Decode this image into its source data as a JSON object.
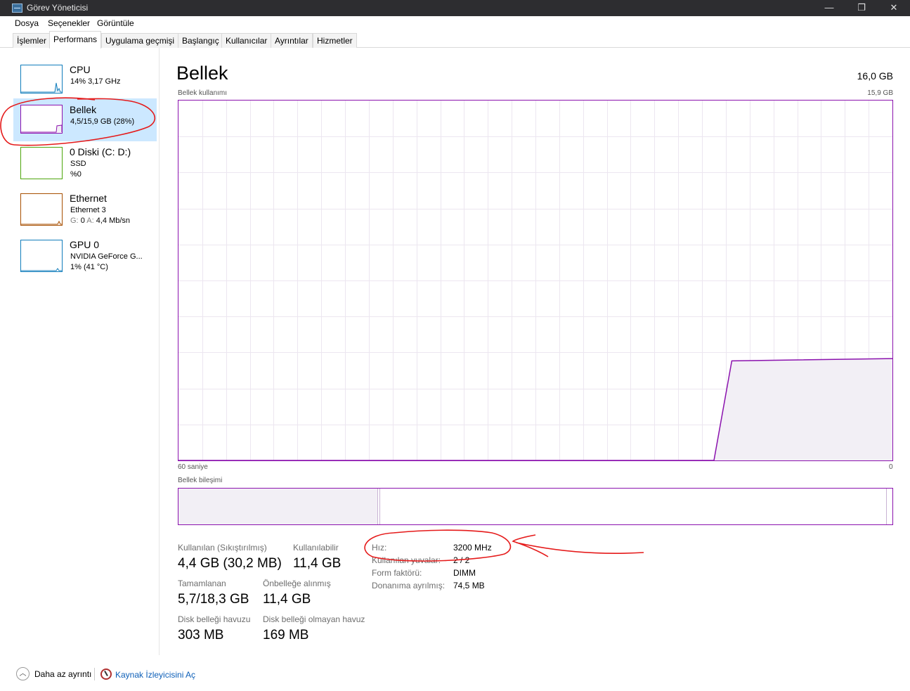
{
  "window": {
    "title": "Görev Yöneticisi",
    "minimize_glyph": "—",
    "maximize_glyph": "❐",
    "close_glyph": "✕"
  },
  "menu": [
    "Dosya",
    "Seçenekler",
    "Görüntüle"
  ],
  "tabs": [
    {
      "label": "İşlemler",
      "active": false
    },
    {
      "label": "Performans",
      "active": true
    },
    {
      "label": "Uygulama geçmişi",
      "active": false
    },
    {
      "label": "Başlangıç",
      "active": false
    },
    {
      "label": "Kullanıcılar",
      "active": false
    },
    {
      "label": "Ayrıntılar",
      "active": false
    },
    {
      "label": "Hizmetler",
      "active": false
    }
  ],
  "sidebar": {
    "items": [
      {
        "name": "CPU",
        "sub1": "14% 3,17 GHz",
        "sub2": "",
        "color": "#117dbb",
        "selected": false
      },
      {
        "name": "Bellek",
        "sub1": "4,5/15,9 GB (28%)",
        "sub2": "",
        "color": "#8b12ae",
        "selected": true
      },
      {
        "name": "0 Diski (C: D:)",
        "sub1": "SSD",
        "sub2": "%0",
        "color": "#4da60c",
        "selected": false
      },
      {
        "name": "Ethernet",
        "sub1": "Ethernet 3",
        "sub2_prefix_g": "G:",
        "sub2_g": "0",
        "sub2_prefix_a": "A:",
        "sub2_a": "4,4 Mb/sn",
        "color": "#a74f01",
        "selected": false
      },
      {
        "name": "GPU 0",
        "sub1": "NVIDIA GeForce G...",
        "sub2": "1% (41 °C)",
        "color": "#117dbb",
        "selected": false
      }
    ]
  },
  "main": {
    "title": "Bellek",
    "total": "16,0 GB",
    "usage_label": "Bellek kullanımı",
    "usage_max": "15,9 GB",
    "time_label": "60 saniye",
    "time_end": "0",
    "composition_label": "Bellek bileşimi",
    "graph_color": "#8b12ae",
    "composition": {
      "in_use_fraction": 0.28,
      "modified_fraction": 0.003,
      "standby_fraction": 0.71
    }
  },
  "stats": {
    "in_use_label": "Kullanılan (Sıkıştırılmış)",
    "in_use_value": "4,4 GB (30,2 MB)",
    "available_label": "Kullanılabilir",
    "available_value": "11,4 GB",
    "committed_label": "Tamamlanan",
    "committed_value": "5,7/18,3 GB",
    "cached_label": "Önbelleğe alınmış",
    "cached_value": "11,4 GB",
    "paged_label": "Disk belleği havuzu",
    "paged_value": "303 MB",
    "nonpaged_label": "Disk belleği olmayan havuz",
    "nonpaged_value": "169 MB"
  },
  "specs": [
    {
      "key": "Hız:",
      "value": "3200 MHz"
    },
    {
      "key": "Kullanılan yuvalar:",
      "value": "2 / 2"
    },
    {
      "key": "Form faktörü:",
      "value": "DIMM"
    },
    {
      "key": "Donanıma ayrılmış:",
      "value": "74,5 MB"
    }
  ],
  "footer": {
    "less_details": "Daha az ayrıntı",
    "resource_monitor": "Kaynak İzleyicisini Aç",
    "chevron_glyph": "︿"
  },
  "chart_data": {
    "type": "area",
    "title": "Bellek kullanımı",
    "xlabel": "60 saniye",
    "ylabel": "",
    "ylim": [
      0,
      15.9
    ],
    "grid": true,
    "series": [
      {
        "x": [
          60,
          15,
          13.5,
          0
        ],
        "values": [
          0,
          0,
          4.4,
          4.5
        ]
      }
    ]
  },
  "annotations": {
    "color": "#e51a1a"
  }
}
